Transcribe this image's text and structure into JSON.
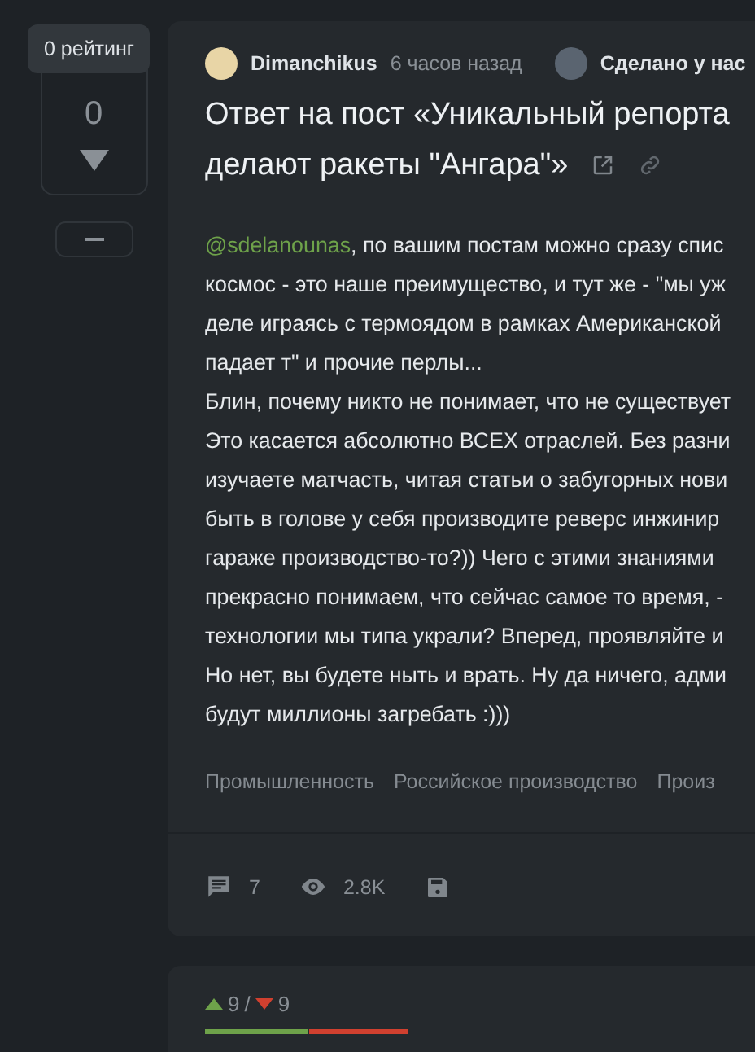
{
  "rating": {
    "tooltip": "0 рейтинг",
    "value": "0"
  },
  "post": {
    "author": "Dimanchikus",
    "time": "6 часов назад",
    "community": "Сделано у нас",
    "title_lines": [
      "Ответ на пост «Уникальный репорта",
      "делают ракеты \"Ангара\"»"
    ],
    "mention": "@sdelanounas",
    "body_lines": [
      ", по вашим постам можно сразу спис",
      "космос - это наше преимущество, и тут же - \"мы уж",
      "деле играясь с термоядом в рамках Американской",
      "падает т\" и прочие перлы...",
      "Блин, почему никто не понимает, что не существует",
      "Это касается абсолютно ВСЕХ отраслей. Без разни",
      "изучаете матчасть, читая статьи о забугорных нови",
      "быть в голове у себя производите реверс инжинир",
      "гараже производство-то?)) Чего с этими знаниями",
      "прекрасно понимаем, что сейчас самое то время, -",
      "технологии мы типа украли? Вперед, проявляйте и",
      "Но нет, вы будете ныть и врать. Ну да ничего, адми",
      "будут миллионы загребать :)))"
    ],
    "tags": [
      "Промышленность",
      "Российское производство",
      "Произ"
    ],
    "comments": "7",
    "views": "2.8K"
  },
  "votes": {
    "up": "9",
    "separator": "/",
    "down": "9",
    "level": 0.5
  }
}
